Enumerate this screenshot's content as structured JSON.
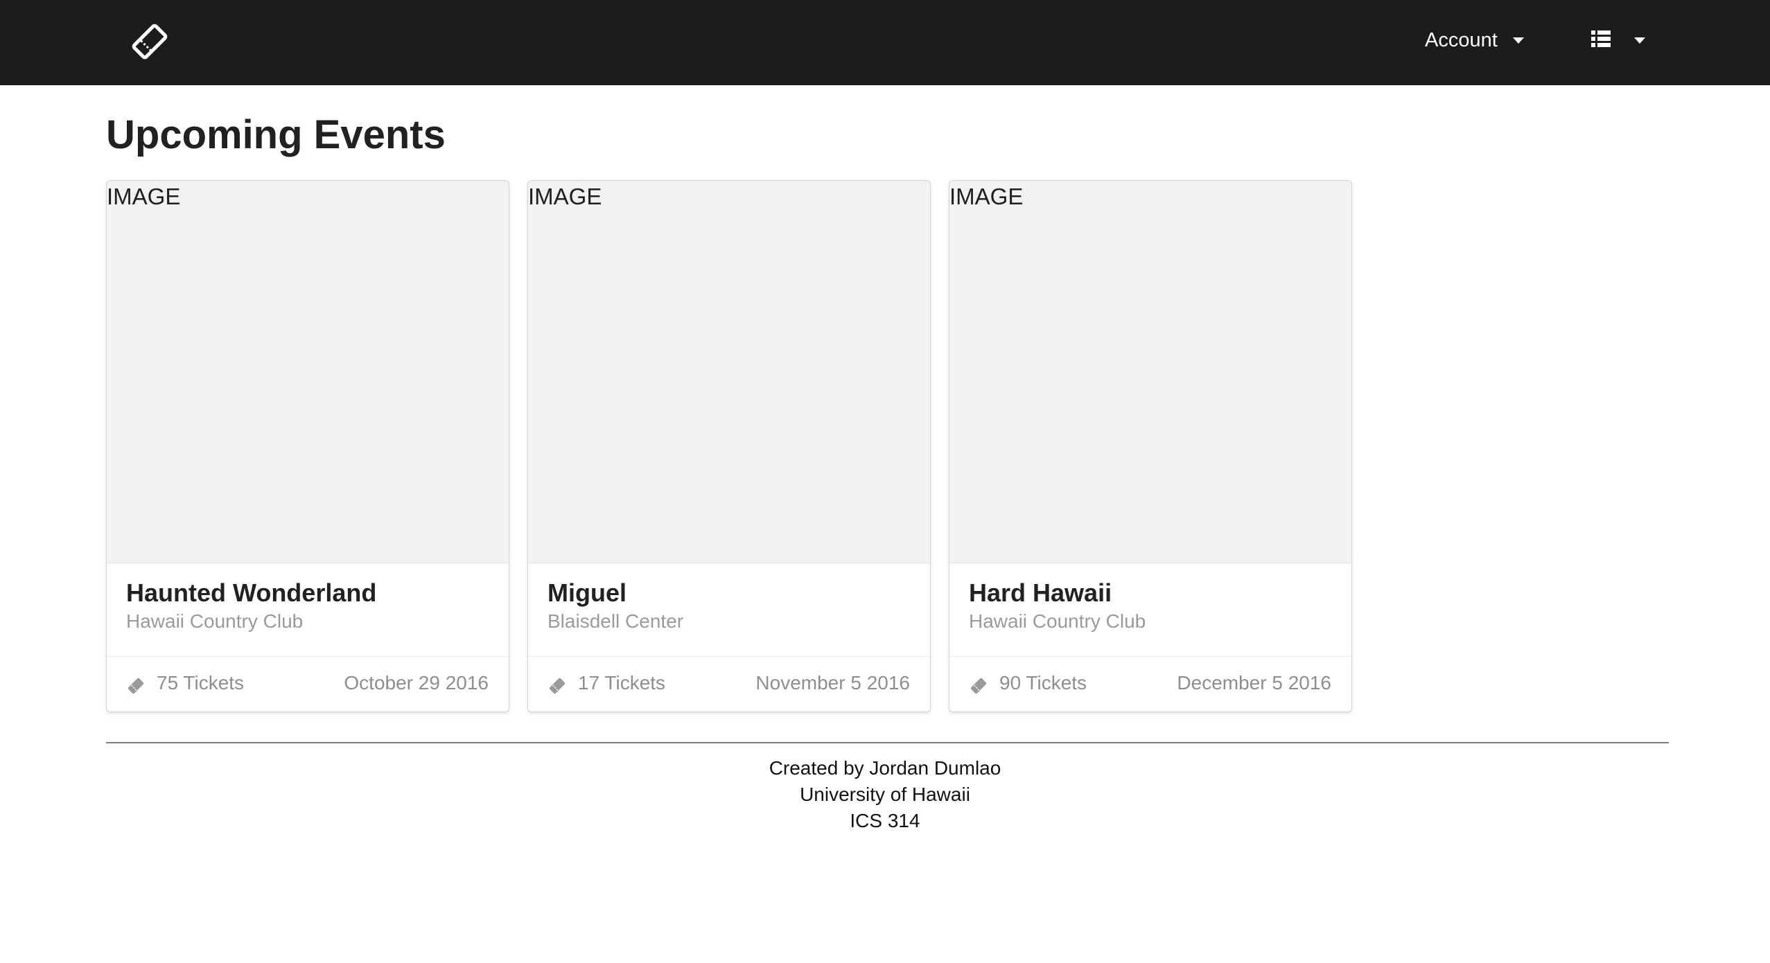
{
  "navbar": {
    "logo_icon": "ticket-icon",
    "account_label": "Account",
    "account_caret_icon": "caret-down-icon",
    "menu_icon": "list-icon",
    "menu_caret_icon": "caret-down-icon"
  },
  "page": {
    "title": "Upcoming Events"
  },
  "events": [
    {
      "image_label": "IMAGE",
      "name": "Haunted Wonderland",
      "venue": "Hawaii Country Club",
      "tickets": "75 Tickets",
      "date": "October 29 2016"
    },
    {
      "image_label": "IMAGE",
      "name": "Miguel",
      "venue": "Blaisdell Center",
      "tickets": "17 Tickets",
      "date": "November 5 2016"
    },
    {
      "image_label": "IMAGE",
      "name": "Hard Hawaii",
      "venue": "Hawaii Country Club",
      "tickets": "90 Tickets",
      "date": "December 5 2016"
    }
  ],
  "footer": {
    "line1": "Created by Jordan Dumlao",
    "line2": "University of Hawaii",
    "line3": "ICS 314"
  },
  "colors": {
    "navbar_bg": "#1b1c1d",
    "card_image_bg": "#f2f2f2",
    "muted_text": "#8e8e8e"
  }
}
